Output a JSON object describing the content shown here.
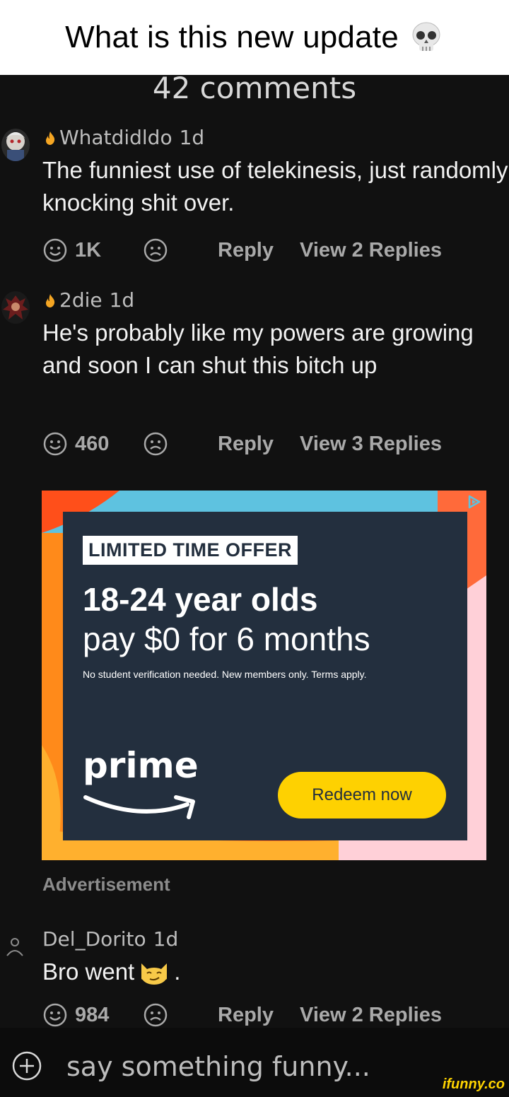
{
  "title": "What is this new update",
  "comments_count": "42 comments",
  "comments": [
    {
      "username": "Whatdidldo",
      "age": "1d",
      "text": "The funniest use of telekinesis, just randomly knocking shit over.",
      "likes": "1K",
      "reply": "Reply",
      "view_replies": "View 2 Replies"
    },
    {
      "username": "2die",
      "age": "1d",
      "text": "He's probably like my powers are growing and soon I can shut this bitch up",
      "likes": "460",
      "reply": "Reply",
      "view_replies": "View 3 Replies"
    },
    {
      "username": "Del_Dorito",
      "age": "1d",
      "text": "Bro went",
      "text_suffix": ".",
      "likes": "984",
      "reply": "Reply",
      "view_replies": "View 2 Replies"
    }
  ],
  "ad": {
    "badge": "LIMITED TIME OFFER",
    "headline_line1": "18-24 year olds",
    "headline_line2": "pay $0 for 6 months",
    "fine_print": "No student verification needed. New members only. Terms apply.",
    "brand": "prime",
    "cta": "Redeem now",
    "label": "Advertisement"
  },
  "composer": {
    "placeholder": "say something funny..."
  },
  "watermark": "ifunny.co",
  "icons": {
    "title_emoji": "skull-icon",
    "fire": "fire-icon",
    "smile": "smiley-face-icon",
    "frown": "frowny-face-icon",
    "add": "plus-circle-icon",
    "cat": "smirking-cat-icon"
  },
  "colors": {
    "background": "#111111",
    "ad_navy": "#232f3e",
    "ad_button": "#fed101",
    "fire": "#f5a623"
  }
}
